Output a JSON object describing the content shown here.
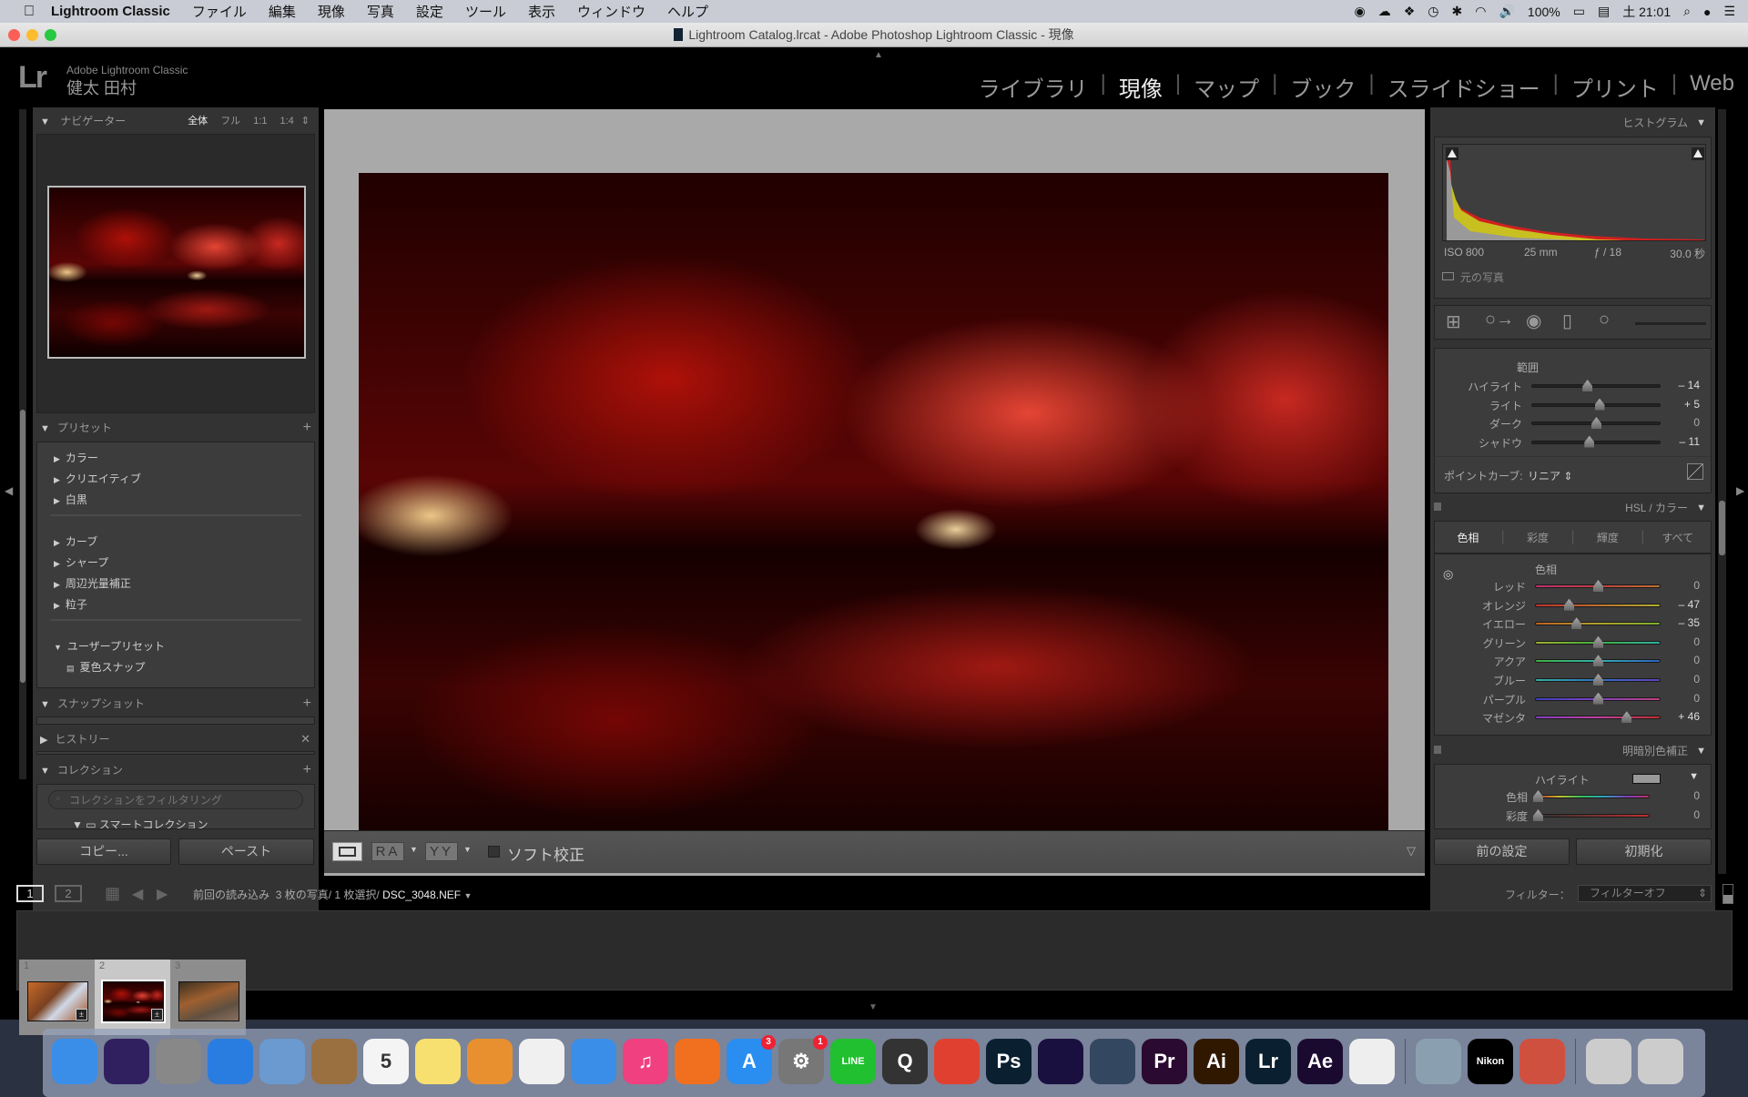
{
  "menubar": {
    "app": "Lightroom Classic",
    "items": [
      "ファイル",
      "編集",
      "現像",
      "写真",
      "設定",
      "ツール",
      "表示",
      "ウィンドウ",
      "ヘルプ"
    ],
    "battery": "100%",
    "clock": "土 21:01"
  },
  "window": {
    "title": "Lightroom Catalog.lrcat - Adobe Photoshop Lightroom Classic - 現像"
  },
  "identity": {
    "logo": "Lr",
    "product": "Adobe Lightroom Classic",
    "user": "健太 田村"
  },
  "modules": [
    {
      "label": "ライブラリ",
      "active": false
    },
    {
      "label": "現像",
      "active": true
    },
    {
      "label": "マップ",
      "active": false
    },
    {
      "label": "ブック",
      "active": false
    },
    {
      "label": "スライドショー",
      "active": false
    },
    {
      "label": "プリント",
      "active": false
    },
    {
      "label": "Web",
      "active": false
    }
  ],
  "left": {
    "navigator": {
      "title": "ナビゲーター",
      "zooms": [
        "全体",
        "フル",
        "1:1",
        "1:4"
      ],
      "active_zoom": "全体"
    },
    "presets": {
      "title": "プリセット",
      "groups1": [
        "カラー",
        "クリエイティブ",
        "白黒"
      ],
      "groups2": [
        "カーブ",
        "シャープ",
        "周辺光量補正",
        "粒子"
      ],
      "user_group": "ユーザープリセット",
      "user_items": [
        "夏色スナップ"
      ]
    },
    "snapshot": {
      "title": "スナップショット"
    },
    "history": {
      "title": "ヒストリー"
    },
    "collections": {
      "title": "コレクション",
      "filter_placeholder": "コレクションをフィルタリング",
      "smart": "スマートコレクション"
    },
    "copy_button": "コピー...",
    "paste_button": "ペースト"
  },
  "toolbar": {
    "view_ra": "RA",
    "view_yy": "YY",
    "soft_proof": "ソフト校正",
    "soft_proof_checked": false
  },
  "right": {
    "histogram": {
      "title": "ヒストグラム",
      "iso": "ISO 800",
      "focal": "25 mm",
      "aperture": "ƒ / 18",
      "shutter": "30.0 秒",
      "original_label": "元の写真"
    },
    "tone": {
      "range_title": "範囲",
      "sliders": [
        {
          "label": "ハイライト",
          "value": -14,
          "display": "– 14"
        },
        {
          "label": "ライト",
          "value": 5,
          "display": "+ 5"
        },
        {
          "label": "ダーク",
          "value": 0,
          "display": "0"
        },
        {
          "label": "シャドウ",
          "value": -11,
          "display": "– 11"
        }
      ],
      "point_curve_label": "ポイントカーブ:",
      "point_curve_value": "リニア"
    },
    "hsl": {
      "title": "HSL / カラー",
      "tabs": [
        "色相",
        "彩度",
        "輝度",
        "すべて"
      ],
      "active_tab": "色相",
      "section_title": "色相",
      "sliders": [
        {
          "label": "レッド",
          "value": 0,
          "display": "0",
          "grad": "linear-gradient(90deg,#c03070,#c04040,#c07030)"
        },
        {
          "label": "オレンジ",
          "value": -47,
          "display": "– 47",
          "grad": "linear-gradient(90deg,#c03030,#c07030,#b0b030)"
        },
        {
          "label": "イエロー",
          "value": -35,
          "display": "– 35",
          "grad": "linear-gradient(90deg,#c06020,#b0a030,#80b030)"
        },
        {
          "label": "グリーン",
          "value": 0,
          "display": "0",
          "grad": "linear-gradient(90deg,#a0b030,#40b040,#30b0a0)"
        },
        {
          "label": "アクア",
          "value": 0,
          "display": "0",
          "grad": "linear-gradient(90deg,#40b040,#30b0b0,#3060c0)"
        },
        {
          "label": "ブルー",
          "value": 0,
          "display": "0",
          "grad": "linear-gradient(90deg,#30b0a0,#3070c0,#6040c0)"
        },
        {
          "label": "パープル",
          "value": 0,
          "display": "0",
          "grad": "linear-gradient(90deg,#4040c0,#8040c0,#c04080)"
        },
        {
          "label": "マゼンタ",
          "value": 46,
          "display": "+ 46",
          "grad": "linear-gradient(90deg,#8040c0,#c040a0,#c03030)"
        }
      ]
    },
    "split": {
      "title": "明暗別色補正",
      "section": "ハイライト",
      "sliders": [
        {
          "label": "色相",
          "value": 0,
          "max": 360,
          "display": "0",
          "grad": "linear-gradient(90deg,#c03030,#c0c030,#30c060,#30a0c0,#8040c0,#c03060)"
        },
        {
          "label": "彩度",
          "value": 0,
          "max": 100,
          "display": "0",
          "grad": "linear-gradient(90deg,#333,#c03030)"
        }
      ]
    },
    "prev_button": "前の設定",
    "reset_button": "初期化"
  },
  "filmstrip": {
    "pages": [
      "1",
      "2"
    ],
    "source": "前回の読み込み",
    "count": "3 枚の写真/ 1 枚選択/",
    "filename": "DSC_3048.NEF",
    "filter_label": "フィルター：",
    "filter_value": "フィルターオフ",
    "thumbs": [
      {
        "num": "1",
        "selected": false
      },
      {
        "num": "2",
        "selected": true
      },
      {
        "num": "3",
        "selected": false
      }
    ]
  },
  "dock": [
    {
      "name": "finder",
      "bg": "#3a8ee8",
      "t": ""
    },
    {
      "name": "siri",
      "bg": "#302060",
      "t": ""
    },
    {
      "name": "launchpad",
      "bg": "#888",
      "t": ""
    },
    {
      "name": "safari",
      "bg": "#2a7de0",
      "t": ""
    },
    {
      "name": "preview",
      "bg": "#6a9ad0",
      "t": ""
    },
    {
      "name": "contacts",
      "bg": "#9a7040",
      "t": ""
    },
    {
      "name": "calendar",
      "bg": "#f4f4f4",
      "t": "5"
    },
    {
      "name": "notes",
      "bg": "#f8e070",
      "t": ""
    },
    {
      "name": "pages",
      "bg": "#e89030",
      "t": ""
    },
    {
      "name": "numbers",
      "bg": "#f0f0f0",
      "t": ""
    },
    {
      "name": "keynote",
      "bg": "#3a8ee8",
      "t": ""
    },
    {
      "name": "itunes",
      "bg": "#f04080",
      "t": "♫"
    },
    {
      "name": "ibooks",
      "bg": "#f07020",
      "t": ""
    },
    {
      "name": "app-store",
      "bg": "#2a8ef0",
      "t": "A",
      "badge": "3"
    },
    {
      "name": "system-preferences",
      "bg": "#777",
      "t": "⚙",
      "badge": "1"
    },
    {
      "name": "line",
      "bg": "#20c030",
      "t": "LINE"
    },
    {
      "name": "quicktime",
      "bg": "#333",
      "t": "Q"
    },
    {
      "name": "chrome",
      "bg": "#e04030",
      "t": ""
    },
    {
      "name": "photoshop",
      "bg": "#0a2030",
      "t": "Ps"
    },
    {
      "name": "media-encoder",
      "bg": "#1a1040",
      "t": ""
    },
    {
      "name": "app-bull",
      "bg": "#334860",
      "t": ""
    },
    {
      "name": "premiere",
      "bg": "#2a0a30",
      "t": "Pr"
    },
    {
      "name": "illustrator",
      "bg": "#301800",
      "t": "Ai"
    },
    {
      "name": "lightroom",
      "bg": "#0a2030",
      "t": "Lr"
    },
    {
      "name": "after-effects",
      "bg": "#1a0a30",
      "t": "Ae"
    },
    {
      "name": "textedit",
      "bg": "#eee",
      "t": ""
    },
    {
      "name": "image-capture",
      "bg": "#8aa0b0",
      "t": ""
    },
    {
      "name": "nikon",
      "bg": "#000",
      "t": "Nikon"
    },
    {
      "name": "kite",
      "bg": "#d05040",
      "t": ""
    },
    {
      "name": "photos-folder",
      "bg": "#ccc",
      "t": ""
    },
    {
      "name": "trash",
      "bg": "#ccc",
      "t": ""
    }
  ]
}
